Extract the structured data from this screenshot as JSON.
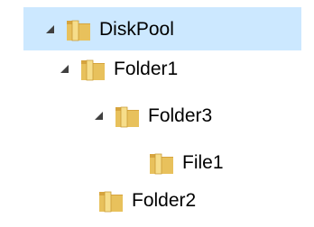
{
  "tree": {
    "items": [
      {
        "label": "DiskPool",
        "expanded": true,
        "selected": true,
        "icon": "folder-icon",
        "depth": 0
      },
      {
        "label": "Folder1",
        "expanded": true,
        "selected": false,
        "icon": "folder-icon",
        "depth": 1
      },
      {
        "label": "Folder3",
        "expanded": true,
        "selected": false,
        "icon": "folder-icon",
        "depth": 2
      },
      {
        "label": "File1",
        "expanded": null,
        "selected": false,
        "icon": "folder-icon",
        "depth": 3
      },
      {
        "label": "Folder2",
        "expanded": null,
        "selected": false,
        "icon": "folder-icon",
        "depth": 1
      }
    ],
    "colors": {
      "selection": "#cce8ff",
      "expander": "#404040",
      "folder_back": "#e2b64f",
      "folder_front": "#f7da82"
    }
  }
}
